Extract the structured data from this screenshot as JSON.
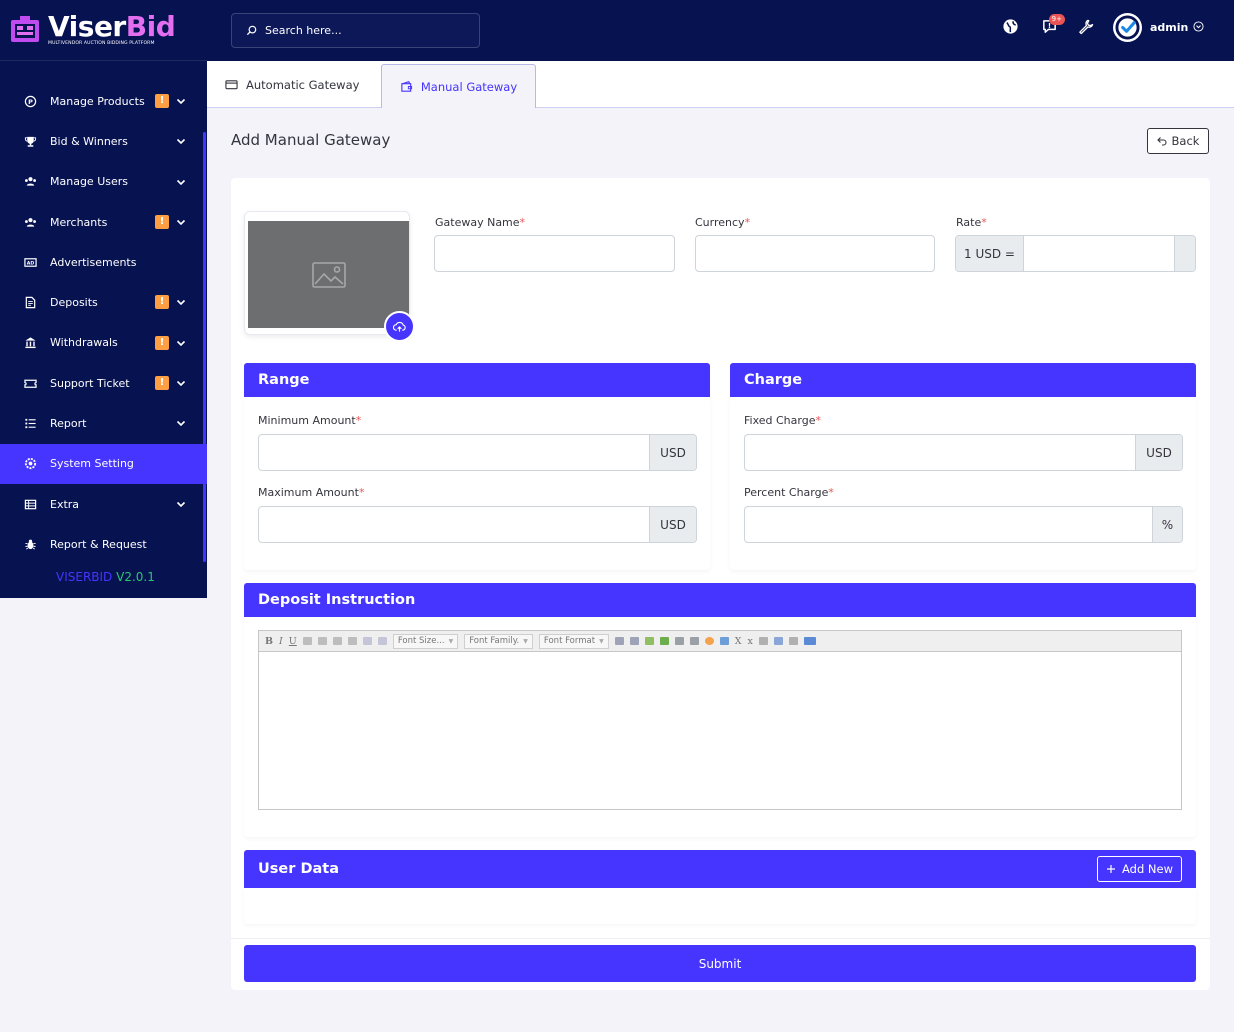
{
  "brand": {
    "name_part1": "Viser",
    "name_part2": "Bid",
    "tagline": "MULTIVENDOR AUCTION BIDDING PLATFORM"
  },
  "sidebar": {
    "items": [
      {
        "label": "Manage Products",
        "icon": "product-icon",
        "warn": "!",
        "chevron": true
      },
      {
        "label": "Bid & Winners",
        "icon": "trophy-icon",
        "warn": null,
        "chevron": true
      },
      {
        "label": "Manage Users",
        "icon": "users-icon",
        "warn": null,
        "chevron": true
      },
      {
        "label": "Merchants",
        "icon": "merchants-icon",
        "warn": "!",
        "chevron": true
      },
      {
        "label": "Advertisements",
        "icon": "ad-icon",
        "warn": null,
        "chevron": false
      },
      {
        "label": "Deposits",
        "icon": "deposit-icon",
        "warn": "!",
        "chevron": true
      },
      {
        "label": "Withdrawals",
        "icon": "bank-icon",
        "warn": "!",
        "chevron": true
      },
      {
        "label": "Support Ticket",
        "icon": "ticket-icon",
        "warn": "!",
        "chevron": true
      },
      {
        "label": "Report",
        "icon": "list-icon",
        "warn": null,
        "chevron": true
      },
      {
        "label": "System Setting",
        "icon": "gear-icon",
        "warn": null,
        "chevron": false,
        "active": true
      },
      {
        "label": "Extra",
        "icon": "grid-icon",
        "warn": null,
        "chevron": true
      },
      {
        "label": "Report & Request",
        "icon": "bug-icon",
        "warn": null,
        "chevron": false
      }
    ],
    "version_name": "VISERBID",
    "version_number": "V2.0.1"
  },
  "topbar": {
    "search_placeholder": "Search here...",
    "notification_badge": "9+",
    "admin_name": "admin"
  },
  "tabs": [
    {
      "label": "Automatic Gateway",
      "active": false
    },
    {
      "label": "Manual Gateway",
      "active": true
    }
  ],
  "page": {
    "title": "Add Manual Gateway",
    "back_label": "Back"
  },
  "form": {
    "gateway_name_label": "Gateway Name",
    "currency_label": "Currency",
    "rate_label": "Rate",
    "rate_prefix": "1 USD =",
    "required_mark": "*",
    "range": {
      "title": "Range",
      "min_label": "Minimum Amount",
      "min_addon": "USD",
      "max_label": "Maximum Amount",
      "max_addon": "USD"
    },
    "charge": {
      "title": "Charge",
      "fixed_label": "Fixed Charge",
      "fixed_addon": "USD",
      "percent_label": "Percent Charge",
      "percent_addon": "%"
    },
    "deposit_instruction": {
      "title": "Deposit Instruction",
      "toolbar": {
        "bold": "B",
        "italic": "I",
        "underline": "U",
        "font_size": "Font Size...",
        "font_family": "Font Family.",
        "font_format": "Font Format",
        "subscript": "X",
        "superscript": "x"
      }
    },
    "user_data": {
      "title": "User Data",
      "add_label": "Add New"
    },
    "submit_label": "Submit"
  }
}
